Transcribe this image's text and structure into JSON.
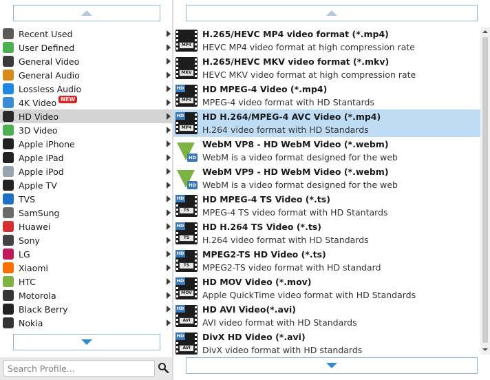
{
  "categories": [
    {
      "label": "Recent Used",
      "icon": "recent-icon",
      "color": "#5a5a5a"
    },
    {
      "label": "User Defined",
      "icon": "user-defined-icon",
      "color": "#4caf50"
    },
    {
      "label": "General Video",
      "icon": "film-icon",
      "color": "#3a3a3a"
    },
    {
      "label": "General Audio",
      "icon": "music-note-icon",
      "color": "#d98a1c"
    },
    {
      "label": "Lossless Audio",
      "icon": "lossless-audio-icon",
      "color": "#1e88e5"
    },
    {
      "label": "4K Video",
      "icon": "4k-icon",
      "color": "#3a8bd4",
      "badge": "NEW"
    },
    {
      "label": "HD Video",
      "icon": "hd-icon",
      "color": "#2a2a2a"
    },
    {
      "label": "3D Video",
      "icon": "3d-icon",
      "color": "#4caf50"
    },
    {
      "label": "Apple iPhone",
      "icon": "iphone-icon",
      "color": "#222222"
    },
    {
      "label": "Apple iPad",
      "icon": "ipad-icon",
      "color": "#222222"
    },
    {
      "label": "Apple iPod",
      "icon": "ipod-icon",
      "color": "#9aa4b0"
    },
    {
      "label": "Apple TV",
      "icon": "apple-tv-icon",
      "color": "#222222"
    },
    {
      "label": "TVS",
      "icon": "tv-icon",
      "color": "#1e6fc8"
    },
    {
      "label": "SamSung",
      "icon": "samsung-icon",
      "color": "#6a6a6a"
    },
    {
      "label": "Huawei",
      "icon": "huawei-icon",
      "color": "#d32f2f"
    },
    {
      "label": "Sony",
      "icon": "sony-icon",
      "color": "#444444"
    },
    {
      "label": "LG",
      "icon": "lg-icon",
      "color": "#c2185b"
    },
    {
      "label": "Xiaomi",
      "icon": "xiaomi-icon",
      "color": "#ff6f00"
    },
    {
      "label": "HTC",
      "icon": "htc-icon",
      "color": "#7cb342"
    },
    {
      "label": "Motorola",
      "icon": "motorola-icon",
      "color": "#333333"
    },
    {
      "label": "Black Berry",
      "icon": "blackberry-icon",
      "color": "#222222"
    },
    {
      "label": "Nokia",
      "icon": "nokia-icon",
      "color": "#333333"
    }
  ],
  "selected_category": "HD Video",
  "search": {
    "placeholder": "Search Profile..."
  },
  "formats": [
    {
      "title": "H.265/HEVC MP4 video format (*.mp4)",
      "desc": "HEVC MP4 video format at high compression rate",
      "icon": "film-mp4-icon",
      "tag": "MP4",
      "hd": false
    },
    {
      "title": "H.265/HEVC MKV video format (*.mkv)",
      "desc": "HEVC MKV video format at high compression rate",
      "icon": "film-mkv-icon",
      "tag": "MKV",
      "hd": false
    },
    {
      "title": "HD MPEG-4 Video (*.mp4)",
      "desc": "MPEG-4 video format with HD Stantards",
      "icon": "hd-mp4-icon",
      "tag": "MP4",
      "hd": true
    },
    {
      "title": "HD H.264/MPEG-4 AVC Video (*.mp4)",
      "desc": "H.264 video format with HD Standards",
      "icon": "hd-mp4-icon",
      "tag": "MP4",
      "hd": true
    },
    {
      "title": "WebM VP8 - HD WebM Video (*.webm)",
      "desc": "WebM is a video format designed for the web",
      "icon": "webm-hd-icon",
      "tag": "HD",
      "hd": false,
      "webm": true
    },
    {
      "title": "WebM VP9 - HD WebM Video (*.webm)",
      "desc": "WebM is a video format designed for the web",
      "icon": "webm-hd-icon",
      "tag": "HD",
      "hd": false,
      "webm": true
    },
    {
      "title": "HD MPEG-4 TS Video (*.ts)",
      "desc": "MPEG-4 TS video format with HD Stantards",
      "icon": "hd-ts-icon",
      "tag": "TS",
      "hd": true
    },
    {
      "title": "HD H.264 TS Video (*.ts)",
      "desc": "H.264 video format with HD Standards",
      "icon": "hd-ts-icon",
      "tag": "TS",
      "hd": true
    },
    {
      "title": "MPEG2-TS HD Video (*.ts)",
      "desc": "MPEG2-TS video format with HD standard",
      "icon": "hd-ts-icon",
      "tag": "TS",
      "hd": true
    },
    {
      "title": "HD MOV Video (*.mov)",
      "desc": "Apple QuickTime video format with HD Standards",
      "icon": "hd-mov-icon",
      "tag": "MOV",
      "hd": true
    },
    {
      "title": "HD AVI Video(*.avi)",
      "desc": "AVI video format with HD Standards",
      "icon": "hd-avi-icon",
      "tag": "AVI",
      "hd": true
    },
    {
      "title": "DivX HD Video (*.avi)",
      "desc": "DivX video format with HD standards",
      "icon": "hd-avi-icon",
      "tag": "AVI",
      "hd": true
    }
  ],
  "selected_format_index": 3,
  "colors": {
    "selected_category_bg": "#d4d4d4",
    "selected_format_bg": "#bfdcf5",
    "accent": "#2d8ad6"
  }
}
